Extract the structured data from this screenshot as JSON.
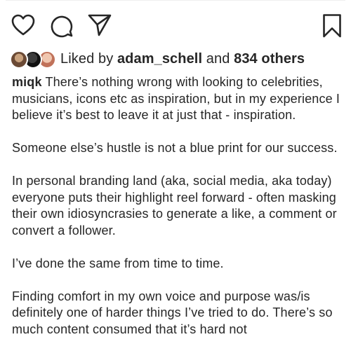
{
  "actions": {
    "like_icon": "heart-icon",
    "comment_icon": "comment-icon",
    "share_icon": "paper-plane-icon",
    "save_icon": "bookmark-icon"
  },
  "likes": {
    "prefix": "Liked by ",
    "user": "adam_schell",
    "middle": " and ",
    "count": "834 others"
  },
  "caption": {
    "username": "miqk",
    "paragraphs": [
      "There’s nothing wrong with looking to celebrities, musicians, icons etc as inspiration, but in my experience I believe it’s best to leave it at just that - inspiration.",
      "Someone else’s hustle is not a blue print for our success.",
      "In personal branding land (aka, social media, aka today) everyone puts their highlight reel forward - often masking their own idiosyncrasies to generate a like, a comment or convert a follower.",
      "I’ve done the same from time to time.",
      "Finding comfort in my own voice and purpose was/is definitely one of harder things I’ve tried to do. There’s so much content consumed that it’s hard not"
    ]
  },
  "colors": {
    "text": "#262626",
    "background": "#ffffff"
  }
}
